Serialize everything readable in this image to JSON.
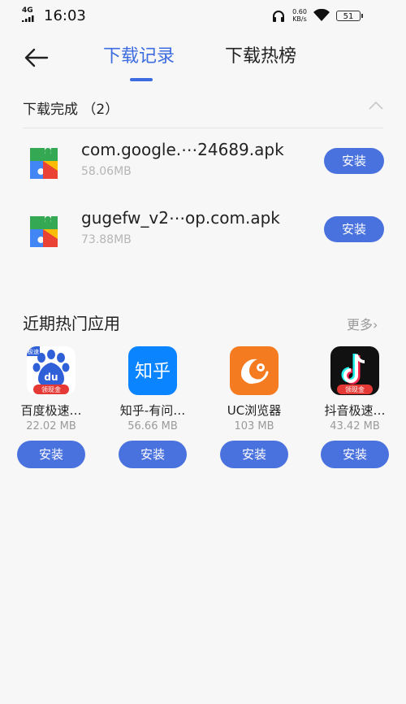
{
  "status_bar": {
    "network": "4G",
    "time": "16:03",
    "speed_value": "0.60",
    "speed_unit": "KB/s",
    "battery": "51"
  },
  "header": {
    "tabs": [
      {
        "label": "下载记录"
      },
      {
        "label": "下载热榜"
      }
    ]
  },
  "downloads": {
    "section_title": "下载完成 （2）",
    "items": [
      {
        "name": "com.google.⋯24689.apk",
        "size": "58.06MB",
        "button": "安装"
      },
      {
        "name": "gugefw_v2⋯op.com.apk",
        "size": "73.88MB",
        "button": "安装"
      }
    ]
  },
  "hot_apps": {
    "title": "近期热门应用",
    "more": "更多",
    "apps": [
      {
        "name": "百度极速…",
        "size": "22.02 MB",
        "button": "安装",
        "icon_badge": "领现金",
        "icon_text": "du",
        "corner_tag": "极速"
      },
      {
        "name": "知乎-有问…",
        "size": "56.66 MB",
        "button": "安装",
        "icon_text": "知乎"
      },
      {
        "name": "UC浏览器",
        "size": "103 MB",
        "button": "安装"
      },
      {
        "name": "抖音极速…",
        "size": "43.42 MB",
        "button": "安装",
        "icon_badge": "领现金"
      }
    ]
  },
  "colors": {
    "accent": "#3c6ce0",
    "button": "#4a72de",
    "zhihu": "#0a84ff",
    "uc": "#f47b20",
    "douyin": "#111111"
  }
}
